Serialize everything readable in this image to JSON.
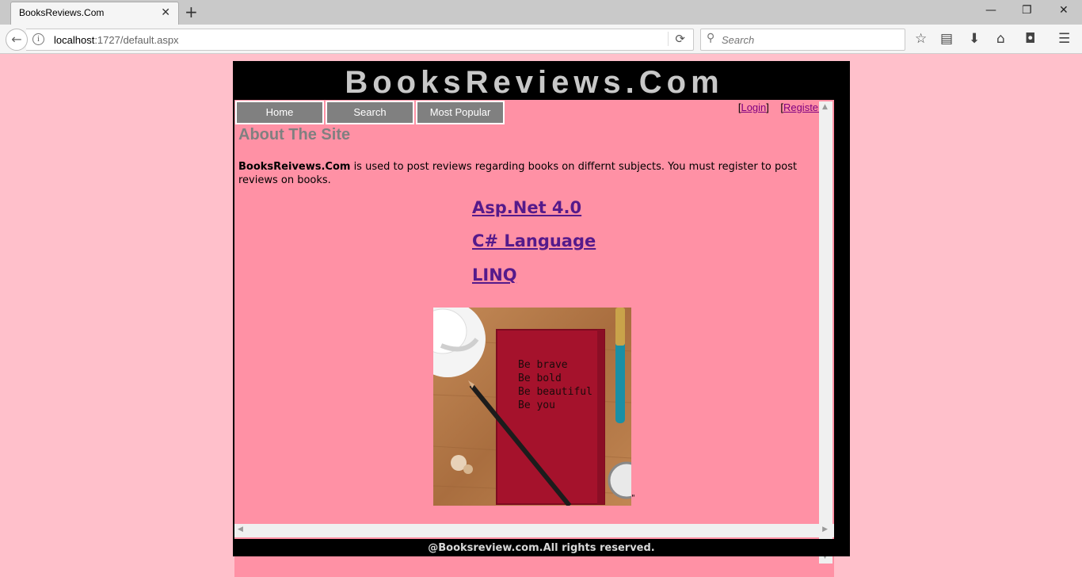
{
  "browser": {
    "tab_title": "BooksReviews.Com",
    "tab_close": "✕",
    "new_tab": "+",
    "url_host": "localhost",
    "url_path": ":1727/default.aspx",
    "search_placeholder": "Search",
    "window_controls": {
      "minimize": "—",
      "restore": "❐",
      "close": "✕"
    },
    "icons": [
      "back-arrow-icon",
      "info-icon",
      "reload-icon",
      "search-icon",
      "bookmark-star-icon",
      "reading-list-icon",
      "download-icon",
      "home-icon",
      "pocket-icon",
      "menu-icon"
    ]
  },
  "site": {
    "title": "BooksReviews.Com",
    "menu": [
      {
        "label": "Home"
      },
      {
        "label": "Search"
      },
      {
        "label": "Most Popular"
      }
    ],
    "auth": {
      "login": "Login",
      "register": "Register"
    },
    "about_title": "About The Site",
    "intro_brand": "BooksReivews.Com",
    "intro_text": " is used to post reviews regarding books on differnt subjects. You must register to post reviews on books.",
    "links": [
      {
        "label": "Asp.Net 4.0"
      },
      {
        "label": "C# Language"
      },
      {
        "label": "LINQ"
      }
    ],
    "image_text": [
      "Be brave",
      "Be bold",
      "Be beautiful",
      "Be you"
    ],
    "image_trailing": "\"",
    "footer": "@Booksreview.com.All rights reserved."
  },
  "colors": {
    "page_background": "#ffc0cb",
    "content_background": "#ff91a5",
    "menu_background": "#808080",
    "link_color": "#551a8b",
    "auth_link_color": "#800080",
    "header_text": "#c8c8c8"
  }
}
